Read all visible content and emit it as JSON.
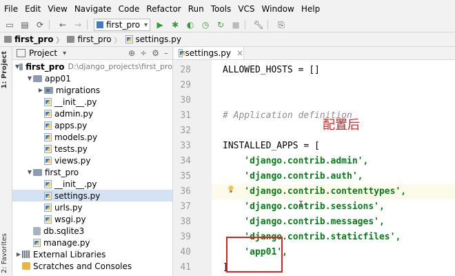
{
  "menu": [
    "File",
    "Edit",
    "View",
    "Navigate",
    "Code",
    "Refactor",
    "Run",
    "Tools",
    "VCS",
    "Window",
    "Help"
  ],
  "toolbar": {
    "run_config": "first_pro",
    "run_config_caret": "▾"
  },
  "breadcrumb": [
    "first_pro",
    "first_pro",
    "settings.py"
  ],
  "left_tool_tabs": {
    "project": "1: Project",
    "favorites": "2: Favorites"
  },
  "project_panel": {
    "title": "Project",
    "title_caret": "▾",
    "tree": [
      {
        "label": "first_pro",
        "hint": "D:\\django_projects\\first_pro",
        "kind": "folder",
        "indent": 0,
        "expanded": true
      },
      {
        "label": "app01",
        "kind": "folder",
        "indent": 1,
        "expanded": true
      },
      {
        "label": "migrations",
        "kind": "pkg",
        "indent": 2,
        "expanded": false
      },
      {
        "label": "__init__.py",
        "kind": "py",
        "indent": 2
      },
      {
        "label": "admin.py",
        "kind": "py",
        "indent": 2
      },
      {
        "label": "apps.py",
        "kind": "py",
        "indent": 2
      },
      {
        "label": "models.py",
        "kind": "py",
        "indent": 2
      },
      {
        "label": "tests.py",
        "kind": "py",
        "indent": 2
      },
      {
        "label": "views.py",
        "kind": "py",
        "indent": 2
      },
      {
        "label": "first_pro",
        "kind": "folder",
        "indent": 1,
        "expanded": true
      },
      {
        "label": "__init__.py",
        "kind": "py",
        "indent": 2
      },
      {
        "label": "settings.py",
        "kind": "py",
        "indent": 2,
        "selected": true
      },
      {
        "label": "urls.py",
        "kind": "py",
        "indent": 2
      },
      {
        "label": "wsgi.py",
        "kind": "py",
        "indent": 2
      },
      {
        "label": "db.sqlite3",
        "kind": "db",
        "indent": 1
      },
      {
        "label": "manage.py",
        "kind": "py",
        "indent": 1
      },
      {
        "label": "External Libraries",
        "kind": "lib",
        "indent": 0,
        "expanded": false
      },
      {
        "label": "Scratches and Consoles",
        "kind": "scratch",
        "indent": 0
      }
    ]
  },
  "editor": {
    "tab_label": "settings.py",
    "tab_close": "×",
    "lines": [
      {
        "n": "28",
        "text": "ALLOWED_HOSTS = []",
        "type": "plain"
      },
      {
        "n": "29",
        "text": "",
        "type": "plain"
      },
      {
        "n": "30",
        "text": "",
        "type": "plain"
      },
      {
        "n": "31",
        "text": "# Application definition",
        "type": "comment"
      },
      {
        "n": "32",
        "text": "",
        "type": "plain"
      },
      {
        "n": "33",
        "text": "INSTALLED_APPS = [",
        "type": "plain"
      },
      {
        "n": "34",
        "text": "    'django.contrib.admin',",
        "type": "str"
      },
      {
        "n": "35",
        "text": "    'django.contrib.auth',",
        "type": "str"
      },
      {
        "n": "36",
        "text": "    'django.contrib.contenttypes',",
        "type": "str"
      },
      {
        "n": "37",
        "text": "    'django.contrib.sessions',",
        "type": "str"
      },
      {
        "n": "38",
        "text": "    'django.contrib.messages',",
        "type": "str"
      },
      {
        "n": "39",
        "text": "    'django.contrib.staticfiles',",
        "type": "str"
      },
      {
        "n": "40",
        "text": "    'app01',",
        "type": "str"
      },
      {
        "n": "41",
        "text": "]",
        "type": "plain"
      }
    ]
  },
  "annotation": {
    "text": "配置后",
    "color": "#e02020"
  },
  "colors": {
    "string": "#067d17",
    "comment": "#8c8c8c",
    "selection": "#d5e2f4",
    "annotation_red": "#e02020"
  }
}
